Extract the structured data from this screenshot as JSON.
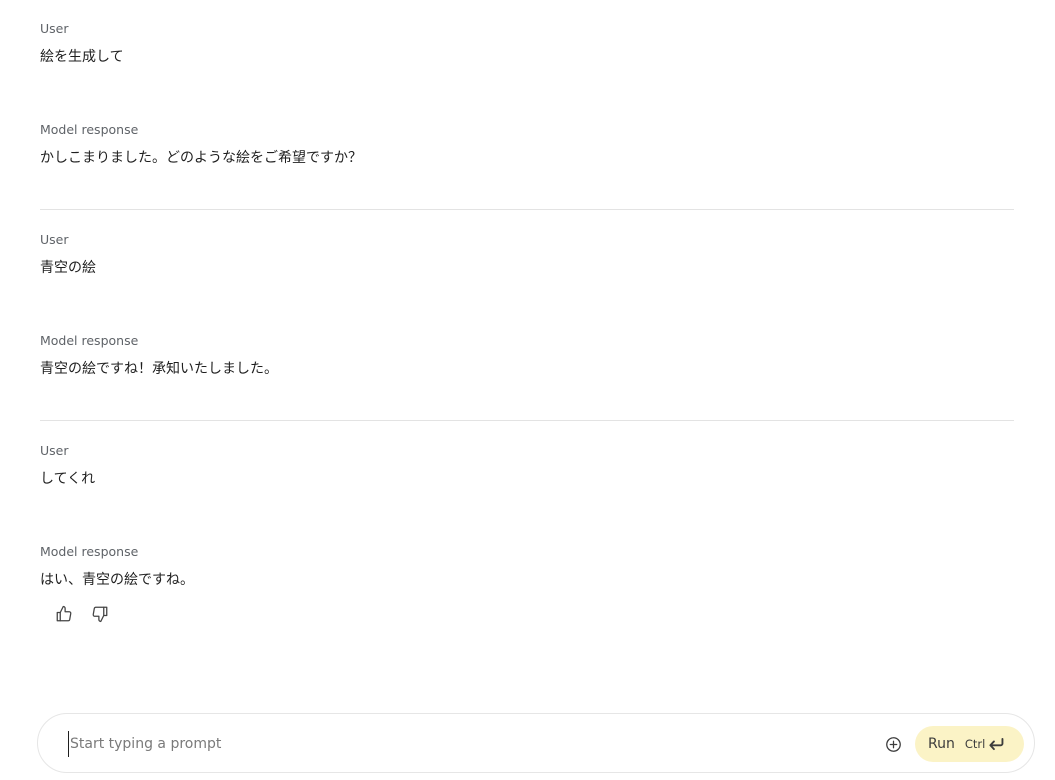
{
  "conversation": [
    {
      "role_label": "User",
      "text": "絵を生成して"
    },
    {
      "role_label": "Model response",
      "text": "かしこまりました。どのような絵をご希望ですか？"
    },
    {
      "role_label": "User",
      "text": "青空の絵"
    },
    {
      "role_label": "Model response",
      "text": "青空の絵ですね！承知いたしました。"
    },
    {
      "role_label": "User",
      "text": "してくれ"
    },
    {
      "role_label": "Model response",
      "text": "はい、青空の絵ですね。"
    }
  ],
  "feedback": {
    "thumbs_up_icon": "thumbs-up-icon",
    "thumbs_down_icon": "thumbs-down-icon"
  },
  "prompt": {
    "placeholder": "Start typing a prompt",
    "value": "",
    "add_icon": "add-circle-icon",
    "run_label": "Run",
    "run_shortcut": "Ctrl",
    "enter_icon": "enter-key-icon"
  },
  "colors": {
    "run_button_bg": "#fbf3c6",
    "divider": "#e3e3e3",
    "label_text": "#5f6368"
  }
}
